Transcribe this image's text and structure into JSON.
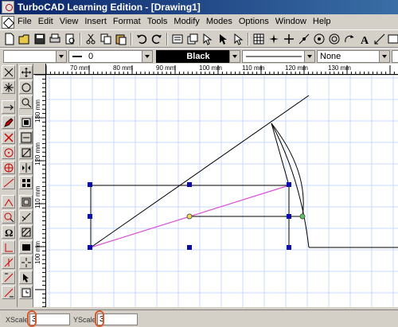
{
  "window": {
    "title": "TurboCAD Learning Edition - [Drawing1]"
  },
  "menu": [
    "File",
    "Edit",
    "View",
    "Insert",
    "Format",
    "Tools",
    "Modify",
    "Modes",
    "Options",
    "Window",
    "Help"
  ],
  "property_bar": {
    "layer_value": "",
    "pen_value": "0",
    "color_value": "Black",
    "linestyle_value": "",
    "fill_value": "None"
  },
  "ruler": {
    "h_labels": [
      "70 mm",
      "80 mm",
      "90 mm",
      "100 mm",
      "110 mm",
      "120 mm",
      "130 mm"
    ],
    "v_labels": [
      "130 mm",
      "120 mm",
      "110 mm",
      "100 mm"
    ]
  },
  "status": {
    "xscale_label": "XScale",
    "xscale_value": "3",
    "yscale_label": "YScale",
    "yscale_value": "3"
  },
  "colors": {
    "selection_handle": "#0a0aa8",
    "magenta_line": "#d84fd8",
    "grid": "#c8d8ff",
    "highlight_ring": "#d8582c"
  }
}
